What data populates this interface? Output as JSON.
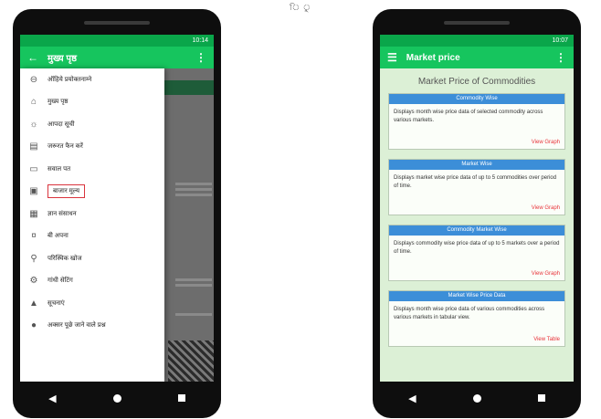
{
  "header_strip": "ি  ু",
  "colors": {
    "green_primary": "#16c55e",
    "green_status": "#0aa64a",
    "card_header_blue": "#3c8ed8",
    "highlight_red": "#d9343d",
    "link_red": "#e8333a",
    "page_bg_green": "#dcf0d6"
  },
  "left_phone": {
    "status_time": "10:14",
    "appbar": {
      "back_icon": "arrow-back-icon",
      "title": "मुख्य पृष्ठ",
      "overflow_icon": "more-vertical-icon"
    },
    "drawer_items": [
      {
        "icon": "account-circle-icon",
        "glyph": "⊖",
        "label": "ऑहिये प्रयोक्तनाम्ने"
      },
      {
        "icon": "home-icon",
        "glyph": "⌂",
        "label": "मुख्य पृष्ठ"
      },
      {
        "icon": "sun-icon",
        "glyph": "☼",
        "label": "आपदा सूची"
      },
      {
        "icon": "document-icon",
        "glyph": "▤",
        "label": "जरूरत फैन करें"
      },
      {
        "icon": "chat-icon",
        "glyph": "▭",
        "label": "सवाल पत"
      },
      {
        "icon": "calendar-icon",
        "glyph": "▣",
        "label": "बाजार मूल्य",
        "highlight": true
      },
      {
        "icon": "gallery-icon",
        "glyph": "▦",
        "label": "ज्ञान संसाधन"
      },
      {
        "icon": "cart-icon",
        "glyph": "¤",
        "label": "बी अपना"
      },
      {
        "icon": "search-icon",
        "glyph": "⚲",
        "label": "परिस्थिक खोज"
      },
      {
        "icon": "settings-icon",
        "glyph": "⚙",
        "label": "गांधी सेटिंग"
      },
      {
        "icon": "bell-icon",
        "glyph": "▲",
        "label": "सूचनाएं"
      },
      {
        "icon": "info-icon",
        "glyph": "●",
        "label": "अक्सर पूछे जाने वाले प्रश्न"
      }
    ]
  },
  "right_phone": {
    "status_time": "10:07",
    "appbar": {
      "menu_icon": "menu-icon",
      "title": "Market price",
      "overflow_icon": "more-vertical-icon"
    },
    "page_title": "Market Price of Commodities",
    "cards": [
      {
        "header": "Commodity Wise",
        "description": "Displays month wise price data of selected commodity across various markets.",
        "link": "View Graph"
      },
      {
        "header": "Market Wise",
        "description": "Displays market wise price data of up to 5 commodities over period of time.",
        "link": "View Graph"
      },
      {
        "header": "Commodity Market Wise",
        "description": "Displays commodity wise price data of up to 5 markets over a period of time.",
        "link": "View Graph"
      },
      {
        "header": "Market Wise Price Data",
        "description": "Displays month wise price data of various commodities across various markets in tabular view.",
        "link": "View Table"
      }
    ]
  }
}
